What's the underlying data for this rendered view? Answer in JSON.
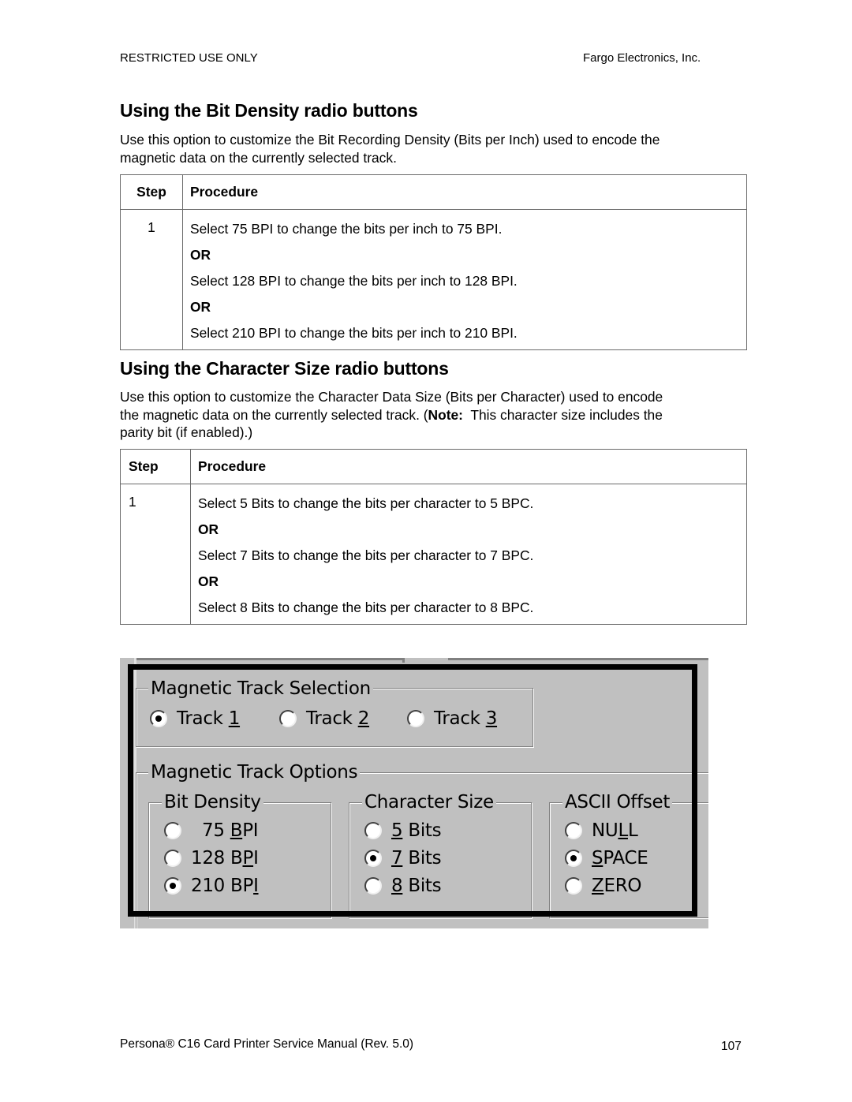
{
  "header": {
    "left": "RESTRICTED USE ONLY",
    "right": "Fargo Electronics, Inc."
  },
  "section1": {
    "title": "Using the Bit Density radio buttons",
    "intro_line1": "Use this option to customize the Bit Recording Density (Bits per Inch) used to encode the",
    "intro_line2": "magnetic data on the currently selected track.",
    "table": {
      "col_step": "Step",
      "col_procedure": "Procedure",
      "step": "1",
      "lines": [
        "Select 75 BPI to change the bits per inch to 75 BPI.",
        "OR",
        "Select 128 BPI to change the bits per inch to 128 BPI.",
        "OR",
        "Select 210 BPI to change the bits per inch to 210 BPI."
      ]
    }
  },
  "section2": {
    "title": "Using the Character Size radio buttons",
    "intro_line1": "Use this option to customize the Character Data Size (Bits per Character) used to encode",
    "intro_line2_a": "the magnetic data on the currently selected track. (",
    "intro_line2_note": "Note:",
    "intro_line2_b": "  This character size includes the",
    "intro_line3": "parity bit (if enabled).)",
    "table": {
      "col_step": "Step",
      "col_procedure": "Procedure",
      "step": "1",
      "lines": [
        "Select 5 Bits to change the bits per character to 5 BPC.",
        "OR",
        "Select 7 Bits to change the bits per character to 7 BPC.",
        "OR",
        "Select 8 Bits to change the bits per character to 8 BPC."
      ]
    }
  },
  "dialog": {
    "track_selection": {
      "legend": "Magnetic Track Selection",
      "options": [
        {
          "label": "Track 1",
          "pre": "Track ",
          "mn": "1",
          "post": "",
          "selected": true
        },
        {
          "label": "Track 2",
          "pre": "Track ",
          "mn": "2",
          "post": "",
          "selected": false
        },
        {
          "label": "Track 3",
          "pre": "Track ",
          "mn": "3",
          "post": "",
          "selected": false
        }
      ]
    },
    "track_options": {
      "legend": "Magnetic Track Options",
      "bit_density": {
        "legend": "Bit Density",
        "options": [
          {
            "label": "75 BPI",
            "pre": "  75 ",
            "mn": "B",
            "post": "PI",
            "selected": false
          },
          {
            "label": "128 BPI",
            "pre": "128 B",
            "mn": "P",
            "post": "I",
            "selected": false
          },
          {
            "label": "210 BPI",
            "pre": "210 BP",
            "mn": "I",
            "post": "",
            "selected": true
          }
        ]
      },
      "character_size": {
        "legend": "Character Size",
        "options": [
          {
            "label": "5 Bits",
            "pre": "",
            "mn": "5",
            "post": " Bits",
            "selected": false
          },
          {
            "label": "7 Bits",
            "pre": "",
            "mn": "7",
            "post": " Bits",
            "selected": true
          },
          {
            "label": "8 Bits",
            "pre": "",
            "mn": "8",
            "post": " Bits",
            "selected": false
          }
        ]
      },
      "ascii_offset": {
        "legend": "ASCII Offset",
        "options": [
          {
            "label": "NULL",
            "pre": "NU",
            "mn": "L",
            "post": "L",
            "selected": false
          },
          {
            "label": "SPACE",
            "pre": "",
            "mn": "S",
            "post": "PACE",
            "selected": true
          },
          {
            "label": "ZERO",
            "pre": "",
            "mn": "Z",
            "post": "ERO",
            "selected": false
          }
        ]
      }
    }
  },
  "footer": {
    "left": "Persona® C16 Card Printer Service Manual (Rev. 5.0)",
    "page_number": "107"
  }
}
